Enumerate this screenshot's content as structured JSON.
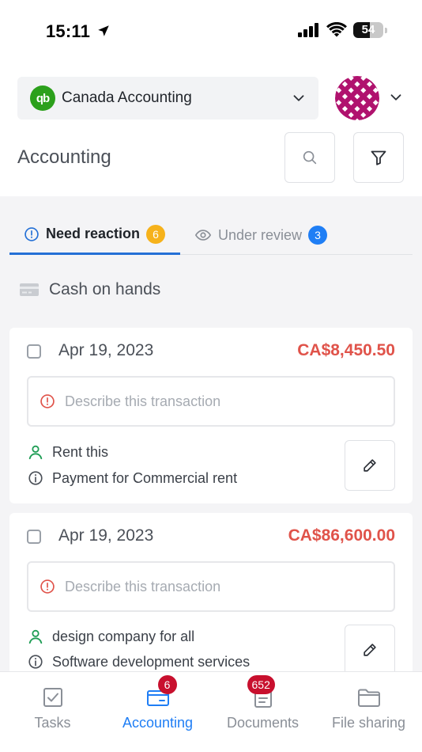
{
  "status_bar": {
    "time": "15:11",
    "battery": "54",
    "battery_level": 0.54
  },
  "header": {
    "company": "Canada Accounting",
    "company_logo_text": "qb",
    "page_title": "Accounting"
  },
  "tabs": [
    {
      "label": "Need reaction",
      "count": "6",
      "active": true
    },
    {
      "label": "Under review",
      "count": "3",
      "active": false
    }
  ],
  "section": {
    "title": "Cash on hands"
  },
  "transactions": [
    {
      "date": "Apr 19, 2023",
      "amount": "CA$8,450.50",
      "placeholder": "Describe this transaction",
      "contact": "Rent this",
      "description": "Payment for Commercial rent"
    },
    {
      "date": "Apr 19, 2023",
      "amount": "CA$86,600.00",
      "placeholder": "Describe this transaction",
      "contact": "design company for all",
      "description": "Software development services"
    }
  ],
  "bottom_nav": [
    {
      "label": "Tasks",
      "badge": ""
    },
    {
      "label": "Accounting",
      "badge": "6",
      "active": true
    },
    {
      "label": "Documents",
      "badge": "652"
    },
    {
      "label": "File sharing",
      "badge": ""
    }
  ],
  "colors": {
    "accent": "#1f7ef5",
    "amount": "#e0534a",
    "warning_badge": "#f6b21b",
    "nav_badge": "#c8102e",
    "qb_green": "#2ca01c",
    "contact_green": "#1f9d55"
  }
}
